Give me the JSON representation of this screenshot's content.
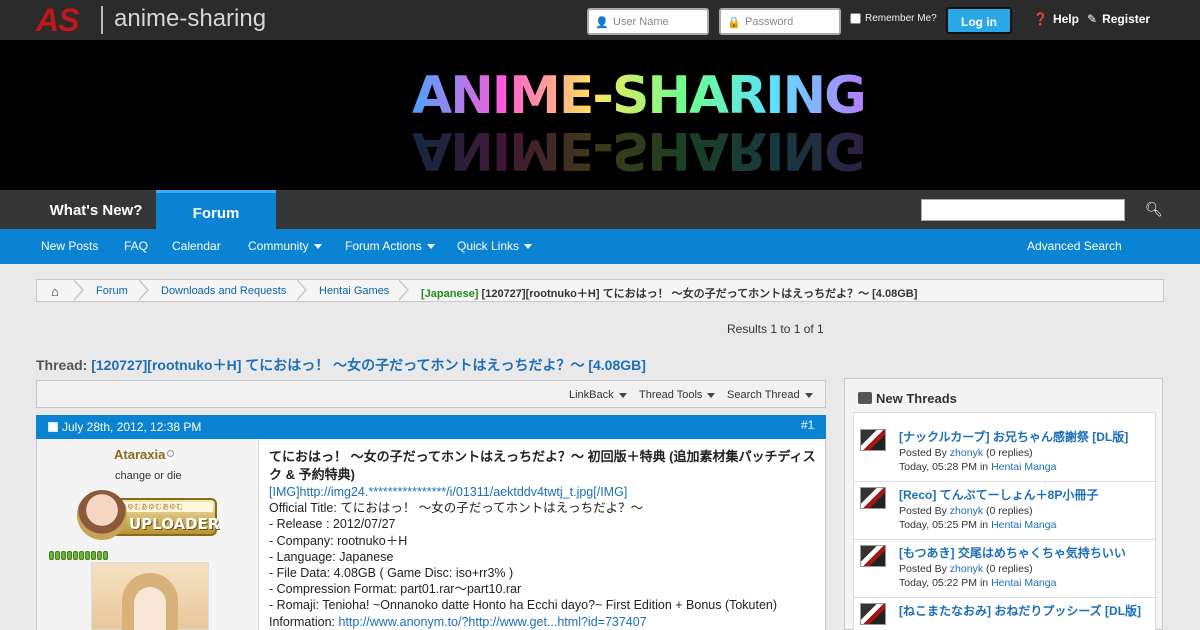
{
  "top": {
    "logo_mark": "AS",
    "logo_text": "anime-sharing",
    "username_placeholder": "User Name",
    "password_placeholder": "Password",
    "remember_label": "Remember Me?",
    "login_label": "Log in",
    "help_label": "Help",
    "register_label": "Register"
  },
  "banner": {
    "logo_text": "ANIME-SHARING"
  },
  "nav": {
    "tabs": [
      {
        "label": "What's New?"
      },
      {
        "label": "Forum"
      }
    ],
    "search_value": ""
  },
  "subnav": {
    "items": [
      {
        "label": "New Posts"
      },
      {
        "label": "FAQ"
      },
      {
        "label": "Calendar"
      },
      {
        "label": "Community"
      },
      {
        "label": "Forum Actions"
      },
      {
        "label": "Quick Links"
      }
    ],
    "advanced_search": "Advanced Search"
  },
  "breadcrumb": {
    "items": [
      "Forum",
      "Downloads and Requests",
      "Hentai Games"
    ],
    "current_prefix": "[Japanese]",
    "current_title": "[120727][rootnuko＋H] てにおはっ！ ～女の子だってホントはえっちだよ？～ [4.08GB]"
  },
  "results": "Results 1 to 1 of 1",
  "thread": {
    "label": "Thread:",
    "title": "[120727][rootnuko＋H] てにおはっ！ ～女の子だってホントはえっちだよ？～ [4.08GB]"
  },
  "tools": {
    "linkback": "LinkBack",
    "thread_tools": "Thread Tools",
    "search_thread": "Search Thread"
  },
  "post": {
    "date": "July 28th, 2012, 12:38 PM",
    "number": "#1",
    "username": "Ataraxia",
    "user_title": "change or die",
    "badge_text": "UPLOADER",
    "badge_strip": "むあゆむあゆむあゆむ",
    "reputation": 10,
    "heading": "てにおはっ！ ～女の子だってホントはえっちだよ？～ 初回版＋特典 (追加素材集パッチディスク & 予約特典)",
    "img_link": "[IMG]http://img24.****************/i/01311/aektddv4twtj_t.jpg[/IMG]",
    "lines": [
      "Official Title: てにおはっ！ ～女の子だってホントはえっちだよ？～",
      "- Release : 2012/07/27",
      "- Company: rootnuko＋H",
      "- Language: Japanese",
      "- File Data: 4.08GB ( Game Disc: iso+rr3% )",
      "- Compression Format: part01.rar～part10.rar",
      "- Romaji: Tenioha! ~Onnanoko datte Honto ha Ecchi dayo?~ First Edition + Bonus (Tokuten)"
    ],
    "info_label": "Information:",
    "info_link": "http://www.anonym.to/?http://www.get...html?id=737407"
  },
  "sidebar": {
    "title": "New Threads",
    "threads": [
      {
        "title": "[ナックルカーブ] お兄ちゃん感謝祭 [DL版]",
        "posted_by": "Posted By",
        "author": "zhonyk",
        "replies": "(0 replies)",
        "time": "Today, 05:28 PM",
        "in": "in",
        "forum": "Hentai Manga"
      },
      {
        "title": "[Reco] てんぶてーしょん＋8P小冊子",
        "posted_by": "Posted By",
        "author": "zhonyk",
        "replies": "(0 replies)",
        "time": "Today, 05:25 PM",
        "in": "in",
        "forum": "Hentai Manga"
      },
      {
        "title": "[もつあき] 交尾はめちゃくちゃ気持ちいい",
        "posted_by": "Posted By",
        "author": "zhonyk",
        "replies": "(0 replies)",
        "time": "Today, 05:22 PM",
        "in": "in",
        "forum": "Hentai Manga"
      },
      {
        "title": "[ねこまたなおみ] おねだりプッシーズ [DL版]",
        "posted_by": "",
        "author": "",
        "replies": "",
        "time": "",
        "in": "",
        "forum": ""
      }
    ]
  }
}
